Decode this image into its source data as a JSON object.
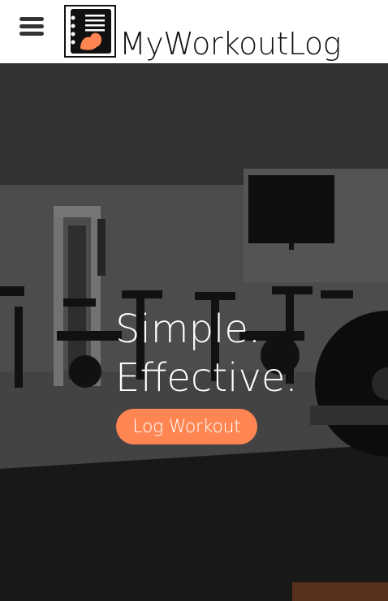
{
  "header": {
    "menu_icon": "hamburger-menu-icon",
    "logo_icon": "notebook-flexed-arm-icon",
    "brand_name": "MyWorkoutLog"
  },
  "hero": {
    "headline_line1": "Simple.",
    "headline_line2": "Effective.",
    "cta_label": "Log Workout",
    "background": "gym-interior-photo"
  },
  "colors": {
    "accent": "#ff8552",
    "header_bg": "#ffffff",
    "text_dark": "#111111",
    "text_light": "#ffffff"
  }
}
